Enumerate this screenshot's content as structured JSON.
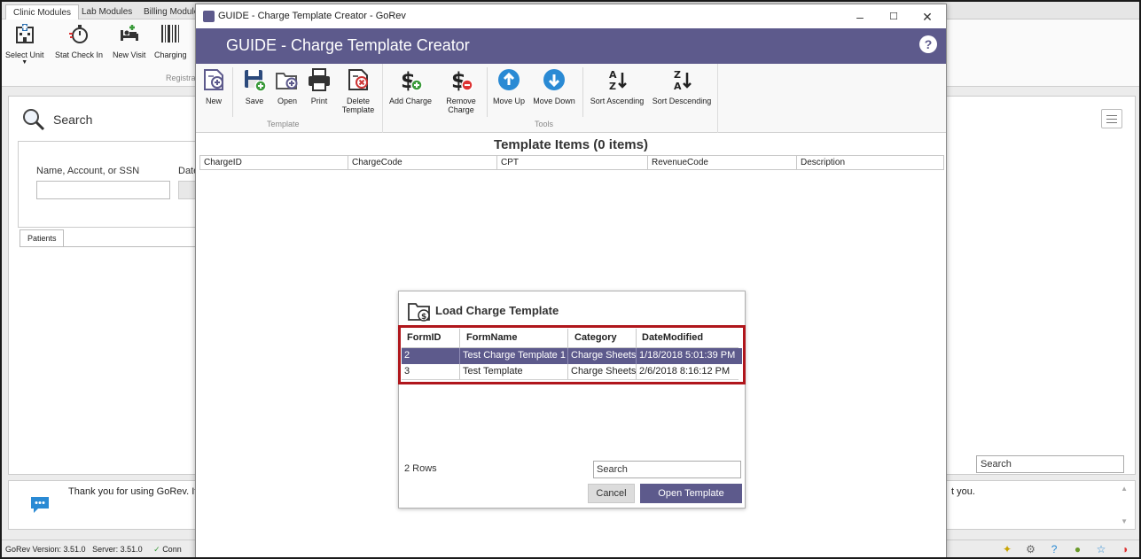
{
  "background_app": {
    "module_tabs": [
      "Clinic Modules",
      "Lab Modules",
      "Billing Modules"
    ],
    "ribbon": {
      "buttons": [
        "Select Unit",
        "Stat Check In",
        "New Visit",
        "Charging"
      ],
      "group_label": "Registra"
    },
    "search": {
      "title": "Search",
      "name_label": "Name, Account, or SSN",
      "date_label": "Date"
    },
    "patients_tab": "Patients",
    "search_right_placeholder": "Search",
    "message": {
      "left_text": "Thank you for using GoRev.  It",
      "right_text": "t you."
    },
    "status": {
      "version": "GoRev Version: 3.51.0",
      "server": "Server: 3.51.0",
      "connection": "Conn"
    }
  },
  "window": {
    "title": "GUIDE - Charge Template Creator - GoRev",
    "header_title": "GUIDE - Charge Template Creator",
    "help_label": "?",
    "controls": {
      "minimize": "–",
      "maximize": "☐",
      "close": "✕"
    }
  },
  "toolbar": {
    "template_group_label": "Template",
    "tools_group_label": "Tools",
    "new_label": "New",
    "save_label": "Save",
    "open_label": "Open",
    "print_label": "Print",
    "delete_label_1": "Delete",
    "delete_label_2": "Template",
    "add_charge_label": "Add Charge",
    "remove_label_1": "Remove",
    "remove_label_2": "Charge",
    "move_up_label": "Move Up",
    "move_down_label": "Move Down",
    "sort_asc_label": "Sort Ascending",
    "sort_desc_label": "Sort Descending"
  },
  "template_items": {
    "title": "Template Items (0 items)",
    "columns": [
      "ChargeID",
      "ChargeCode",
      "CPT",
      "RevenueCode",
      "Description"
    ]
  },
  "load_dialog": {
    "title": "Load Charge Template",
    "columns": [
      "FormID",
      "FormName",
      "Category",
      "DateModified"
    ],
    "rows": [
      {
        "form_id": "2",
        "form_name": "Test Charge Template 1",
        "category": "Charge Sheets",
        "date_modified": "1/18/2018 5:01:39 PM"
      },
      {
        "form_id": "3",
        "form_name": "Test Template",
        "category": "Charge Sheets",
        "date_modified": "2/6/2018 8:16:12 PM"
      }
    ],
    "row_count": "2 Rows",
    "search_value": "Search",
    "cancel_label": "Cancel",
    "open_label": "Open Template"
  },
  "colors": {
    "brand_purple": "#5d5a8c",
    "highlight_red": "#b0161c"
  }
}
